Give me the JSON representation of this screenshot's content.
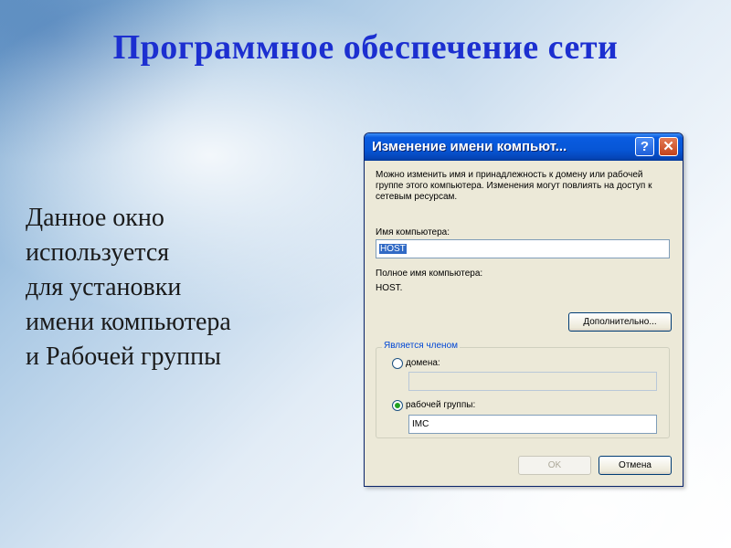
{
  "slide": {
    "title": "Программное обеспечение сети",
    "description_lines": [
      "Данное окно",
      "используется",
      "для установки",
      "имени компьютера",
      "и Рабочей группы"
    ]
  },
  "dialog": {
    "title": "Изменение имени компьют...",
    "help_label": "?",
    "close_label": "✕",
    "intro_text": "Можно изменить имя и принадлежность к домену или рабочей группе этого компьютера. Изменения могут повлиять на доступ к сетевым ресурсам.",
    "computer_name_label": "Имя компьютера:",
    "computer_name_value": "HOST",
    "full_name_label": "Полное имя компьютера:",
    "full_name_value": "HOST.",
    "more_button": "Дополнительно...",
    "member_of_label": "Является членом",
    "domain_label": "домена:",
    "domain_value": "",
    "workgroup_label": "рабочей группы:",
    "workgroup_value": "IMC",
    "workgroup_selected": true,
    "ok_button": "OK",
    "cancel_button": "Отмена"
  },
  "colors": {
    "title": "#1c2fd0",
    "titlebar": "#0756d6",
    "dialog_bg": "#ece9d8"
  }
}
